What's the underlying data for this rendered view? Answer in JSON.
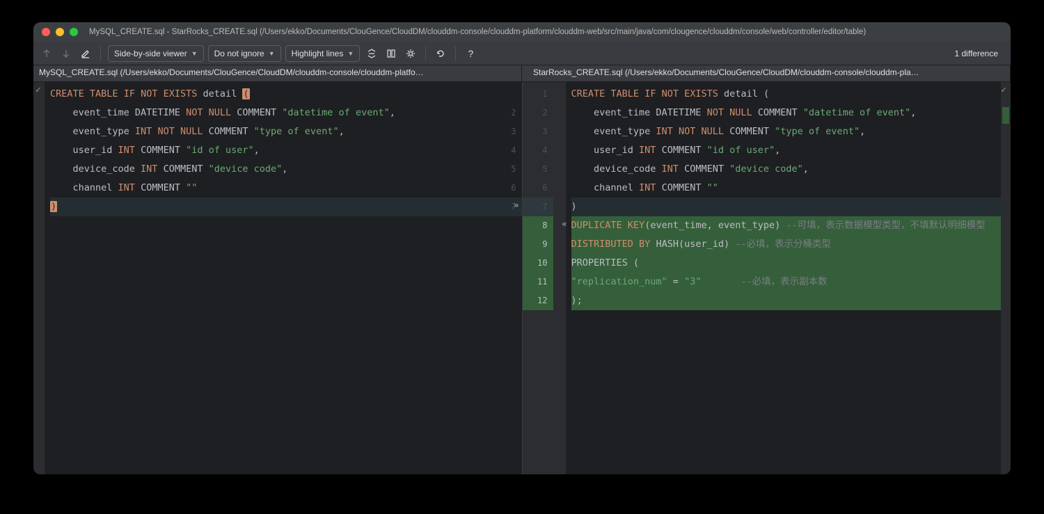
{
  "window": {
    "title": "MySQL_CREATE.sql - StarRocks_CREATE.sql (/Users/ekko/Documents/ClouGence/CloudDM/clouddm-console/clouddm-platform/clouddm-web/src/main/java/com/clougence/clouddm/console/web/controller/editor/table)"
  },
  "toolbar": {
    "viewer_mode": "Side-by-side viewer",
    "ignore_mode": "Do not ignore",
    "highlight_mode": "Highlight lines",
    "diff_count": "1 difference"
  },
  "files": {
    "left": "MySQL_CREATE.sql (/Users/ekko/Documents/ClouGence/CloudDM/clouddm-console/clouddm-platfo…",
    "right": "StarRocks_CREATE.sql (/Users/ekko/Documents/ClouGence/CloudDM/clouddm-console/clouddm-pla…"
  },
  "left_code": {
    "lines": [
      {
        "n": "",
        "tokens": [
          [
            "kw",
            "CREATE"
          ],
          [
            "id",
            " "
          ],
          [
            "kw",
            "TABLE"
          ],
          [
            "id",
            " "
          ],
          [
            "kw",
            "IF"
          ],
          [
            "id",
            " "
          ],
          [
            "kw",
            "NOT"
          ],
          [
            "id",
            " "
          ],
          [
            "kw",
            "EXISTS"
          ],
          [
            "id",
            " detail "
          ],
          [
            "paren-hl",
            "("
          ]
        ]
      },
      {
        "n": "",
        "tokens": [
          [
            "id",
            "    event_time DATETIME "
          ],
          [
            "kw",
            "NOT"
          ],
          [
            "id",
            " "
          ],
          [
            "kw",
            "NULL"
          ],
          [
            "id",
            " COMMENT "
          ],
          [
            "str",
            "\"datetime of event\""
          ],
          [
            "id",
            ","
          ]
        ]
      },
      {
        "n": "",
        "tokens": [
          [
            "id",
            "    event_type "
          ],
          [
            "typ",
            "INT"
          ],
          [
            "id",
            " "
          ],
          [
            "kw",
            "NOT"
          ],
          [
            "id",
            " "
          ],
          [
            "kw",
            "NULL"
          ],
          [
            "id",
            " COMMENT "
          ],
          [
            "str",
            "\"type of event\""
          ],
          [
            "id",
            ","
          ]
        ]
      },
      {
        "n": "",
        "tokens": [
          [
            "id",
            "    user_id "
          ],
          [
            "typ",
            "INT"
          ],
          [
            "id",
            " COMMENT "
          ],
          [
            "str",
            "\"id of user\""
          ],
          [
            "id",
            ","
          ]
        ]
      },
      {
        "n": "",
        "tokens": [
          [
            "id",
            "    device_code "
          ],
          [
            "typ",
            "INT"
          ],
          [
            "id",
            " COMMENT "
          ],
          [
            "str",
            "\"device code\""
          ],
          [
            "id",
            ","
          ]
        ]
      },
      {
        "n": "",
        "tokens": [
          [
            "id",
            "    channel "
          ],
          [
            "typ",
            "INT"
          ],
          [
            "id",
            " COMMENT "
          ],
          [
            "str",
            "\"\""
          ]
        ]
      },
      {
        "n": "",
        "tokens": [
          [
            "paren-hl",
            ")"
          ]
        ],
        "cls": "linechanged"
      }
    ],
    "numbers_right": [
      "",
      "2",
      "3",
      "4",
      "5",
      "6",
      "7"
    ]
  },
  "right_code": {
    "numbers_left": [
      "1",
      "2",
      "3",
      "4",
      "5",
      "6",
      "7",
      "8",
      "9",
      "10",
      "11",
      "12"
    ],
    "lines": [
      {
        "tokens": [
          [
            "kw",
            "CREATE"
          ],
          [
            "id",
            " "
          ],
          [
            "kw",
            "TABLE"
          ],
          [
            "id",
            " "
          ],
          [
            "kw",
            "IF"
          ],
          [
            "id",
            " "
          ],
          [
            "kw",
            "NOT"
          ],
          [
            "id",
            " "
          ],
          [
            "kw",
            "EXISTS"
          ],
          [
            "id",
            " detail ("
          ]
        ]
      },
      {
        "tokens": [
          [
            "id",
            "    event_time DATETIME "
          ],
          [
            "kw",
            "NOT"
          ],
          [
            "id",
            " "
          ],
          [
            "kw",
            "NULL"
          ],
          [
            "id",
            " COMMENT "
          ],
          [
            "str",
            "\"datetime of event\""
          ],
          [
            "id",
            ","
          ]
        ]
      },
      {
        "tokens": [
          [
            "id",
            "    event_type "
          ],
          [
            "typ",
            "INT"
          ],
          [
            "id",
            " "
          ],
          [
            "kw",
            "NOT"
          ],
          [
            "id",
            " "
          ],
          [
            "kw",
            "NULL"
          ],
          [
            "id",
            " COMMENT "
          ],
          [
            "str",
            "\"type of event\""
          ],
          [
            "id",
            ","
          ]
        ]
      },
      {
        "tokens": [
          [
            "id",
            "    user_id "
          ],
          [
            "typ",
            "INT"
          ],
          [
            "id",
            " COMMENT "
          ],
          [
            "str",
            "\"id of user\""
          ],
          [
            "id",
            ","
          ]
        ]
      },
      {
        "tokens": [
          [
            "id",
            "    device_code "
          ],
          [
            "typ",
            "INT"
          ],
          [
            "id",
            " COMMENT "
          ],
          [
            "str",
            "\"device code\""
          ],
          [
            "id",
            ","
          ]
        ]
      },
      {
        "tokens": [
          [
            "id",
            "    channel "
          ],
          [
            "typ",
            "INT"
          ],
          [
            "id",
            " COMMENT "
          ],
          [
            "str",
            "\"\""
          ]
        ]
      },
      {
        "tokens": [
          [
            "id",
            ")"
          ]
        ],
        "cls": "linechanged"
      },
      {
        "tokens": [
          [
            "kw",
            "DUPLICATE"
          ],
          [
            "id",
            " "
          ],
          [
            "kw",
            "KEY"
          ],
          [
            "id",
            "(event_time, event_type) "
          ],
          [
            "com",
            "--可填，表示数据模型类型，不填默认明细模型"
          ]
        ],
        "cls": "lineadded"
      },
      {
        "tokens": [
          [
            "kw",
            "DISTRIBUTED"
          ],
          [
            "id",
            " "
          ],
          [
            "kw",
            "BY"
          ],
          [
            "id",
            " HASH(user_id) "
          ],
          [
            "com",
            "--必填，表示分桶类型"
          ]
        ],
        "cls": "lineadded"
      },
      {
        "tokens": [
          [
            "id",
            "PROPERTIES ("
          ]
        ],
        "cls": "lineadded"
      },
      {
        "tokens": [
          [
            "str",
            "\"replication_num\""
          ],
          [
            "id",
            " = "
          ],
          [
            "str",
            "\"3\""
          ],
          [
            "id",
            "       "
          ],
          [
            "com",
            "--必填，表示副本数"
          ]
        ],
        "cls": "lineadded"
      },
      {
        "tokens": [
          [
            "id",
            ");"
          ]
        ],
        "cls": "lineadded"
      }
    ]
  }
}
